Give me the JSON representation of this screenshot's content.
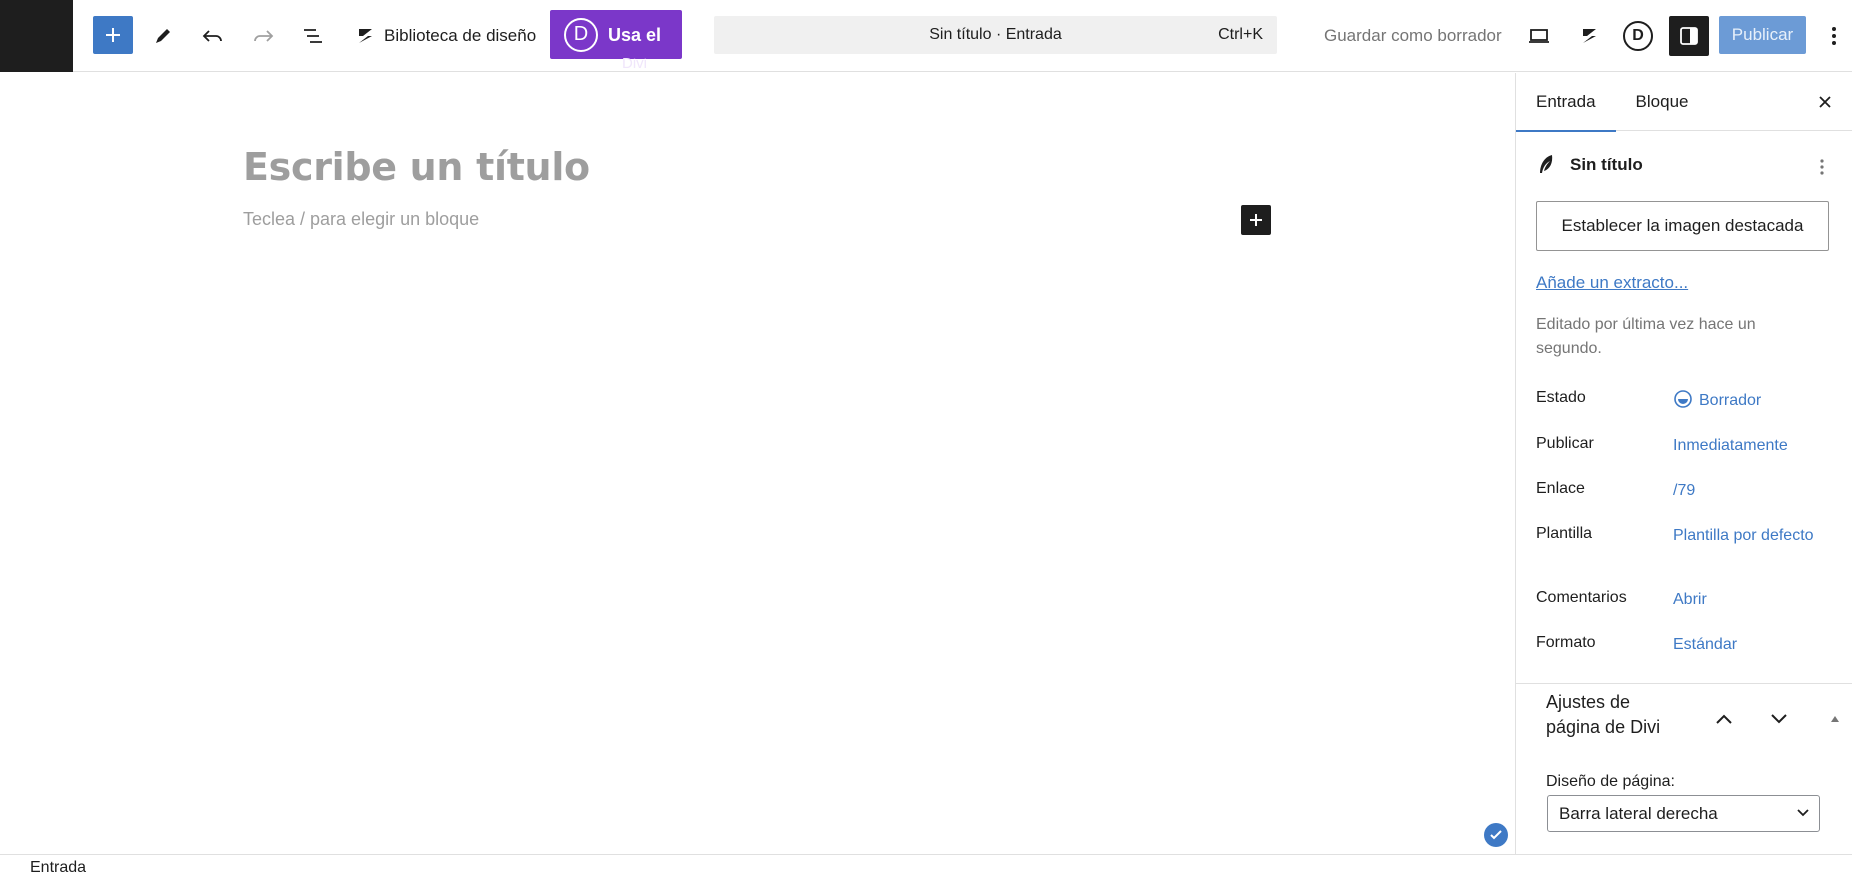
{
  "toolbar": {
    "design_library_label": "Biblioteca de diseño",
    "divi_cta_label": "Usa el",
    "divi_cta_overflow": "Divi",
    "divi_logo_letter": "D",
    "command_center_label": "Sin título · Entrada",
    "command_shortcut": "Ctrl+K",
    "save_draft_label": "Guardar como borrador",
    "publish_label": "Publicar",
    "user_avatar_letter": "D"
  },
  "editor": {
    "title_placeholder": "Escribe un título",
    "block_placeholder": "Teclea / para elegir un bloque"
  },
  "sidebar": {
    "tabs": [
      {
        "label": "Entrada",
        "active": true
      },
      {
        "label": "Bloque",
        "active": false
      }
    ],
    "post_title": "Sin título",
    "featured_image_label": "Establecer la imagen destacada",
    "excerpt_link": "Añade un extracto...",
    "last_edited": "Editado por última vez hace un segundo.",
    "meta": [
      {
        "key": "Estado",
        "value": "Borrador"
      },
      {
        "key": "Publicar",
        "value": "Inmediatamente"
      },
      {
        "key": "Enlace",
        "value": "/79"
      },
      {
        "key": "Plantilla",
        "value": "Plantilla por defecto"
      },
      {
        "key": "Comentarios",
        "value": "Abrir"
      },
      {
        "key": "Formato",
        "value": "Estándar"
      }
    ],
    "divi_panel": {
      "title": "Ajustes de página de Divi",
      "layout_label": "Diseño de página:",
      "layout_value": "Barra lateral derecha"
    }
  },
  "footer": {
    "breadcrumb": "Entrada"
  },
  "colors": {
    "accent": "#3e79c5",
    "divi_purple": "#7b37c9",
    "dark": "#1e1e1e"
  }
}
